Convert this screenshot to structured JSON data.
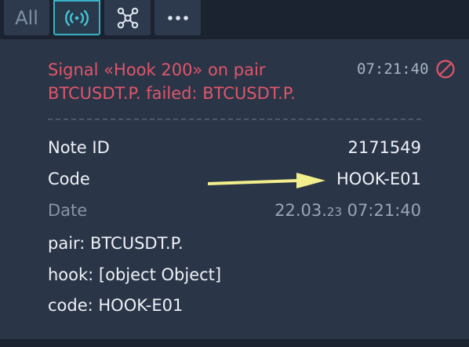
{
  "tabs": {
    "all_label": "All"
  },
  "notification": {
    "message": "Signal «Hook 200» on pair\nBTCUSDT.P. failed:  BTCUSDT.P.",
    "time": "07:21:40",
    "icon": "ban-icon",
    "accent_color": "#e0566a"
  },
  "details": {
    "note_id_label": "Note ID",
    "note_id_value": "2171549",
    "code_label": "Code",
    "code_value": "HOOK-E01",
    "date_label": "Date",
    "date_prefix": "22.03.",
    "date_year": "23",
    "date_time": " 07:21:40"
  },
  "payload": {
    "pair": "pair: BTCUSDT.P.",
    "hook": "hook: [object Object]",
    "code": "code: HOOK-E01"
  },
  "annotation": {
    "arrow_color": "#f3ee8d"
  }
}
